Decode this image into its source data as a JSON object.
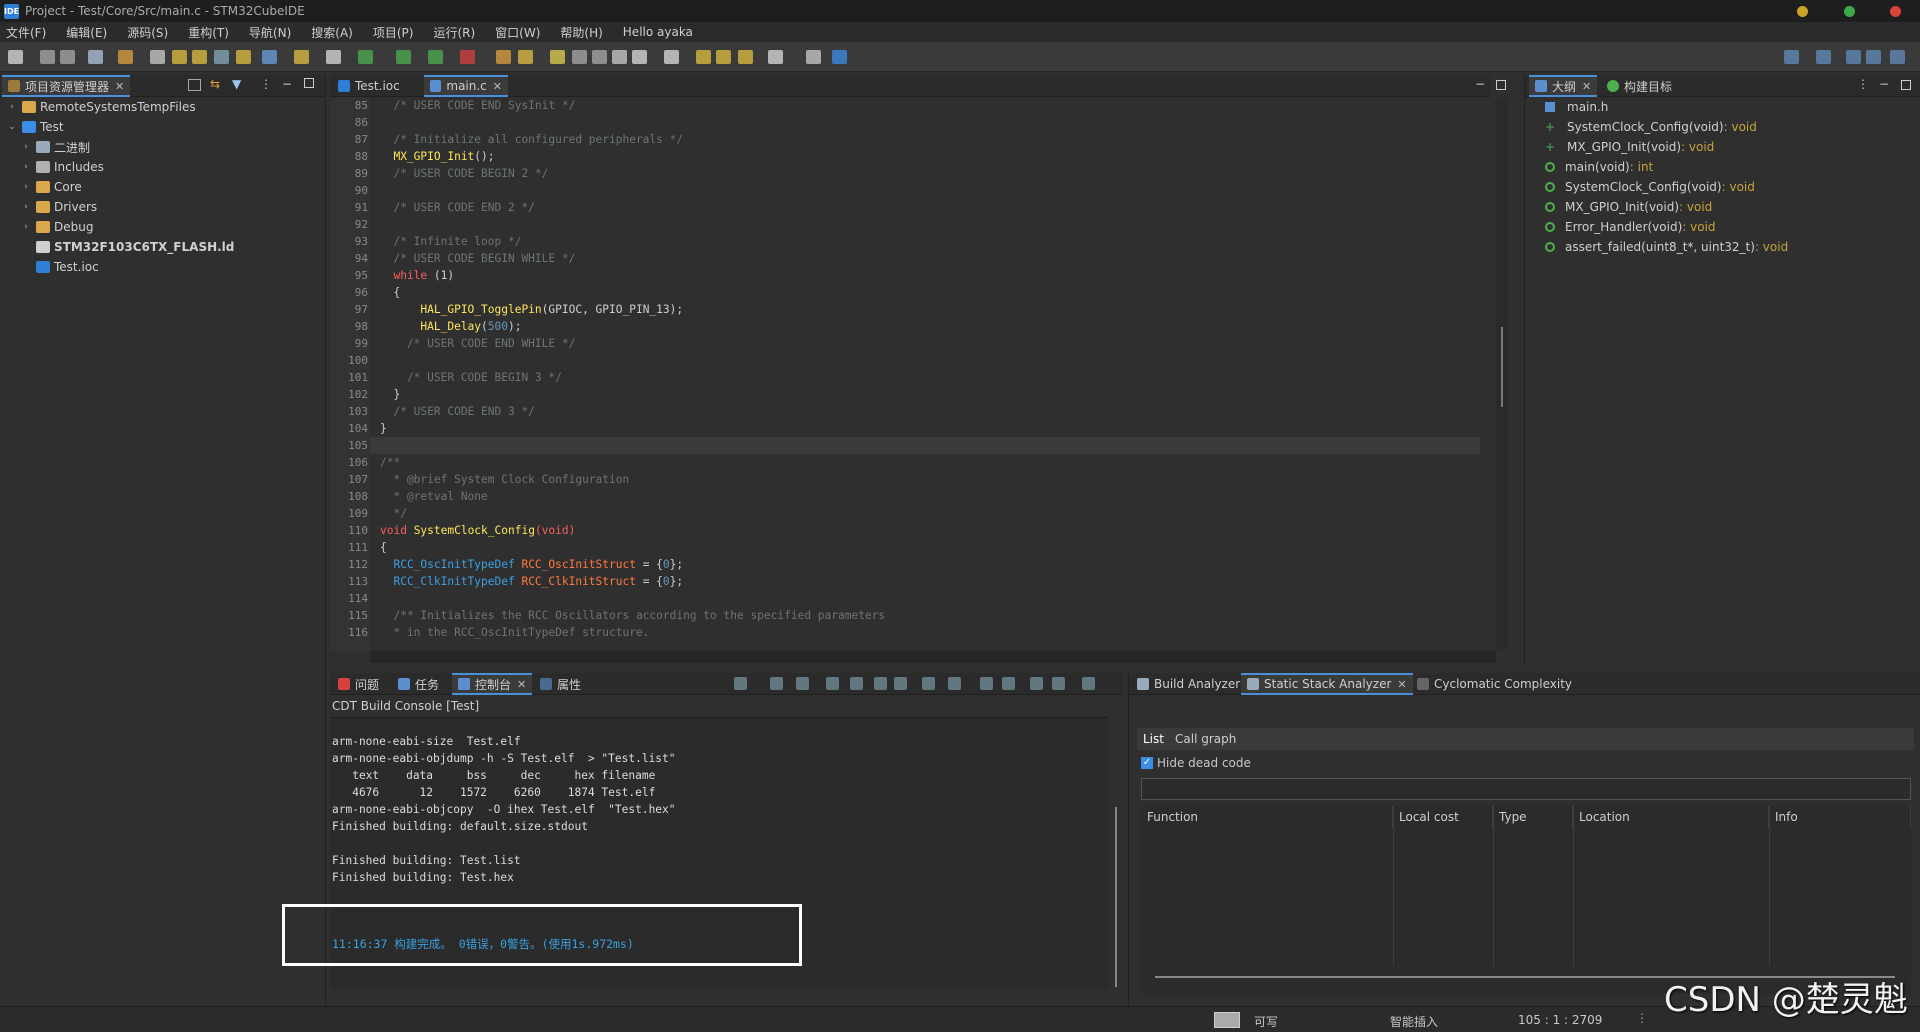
{
  "window": {
    "title": "Project - Test/Core/Src/main.c - STM32CubeIDE",
    "badge": "IDE"
  },
  "menu": [
    "文件(F)",
    "编辑(E)",
    "源码(S)",
    "重构(T)",
    "导航(N)",
    "搜索(A)",
    "项目(P)",
    "运行(R)",
    "窗口(W)",
    "帮助(H)",
    "Hello ayaka"
  ],
  "project_explorer": {
    "tab_label": "项目资源管理器",
    "items": [
      {
        "label": "RemoteSystemsTempFiles",
        "depth": 0,
        "arrow": "›",
        "icon": "folder"
      },
      {
        "label": "Test",
        "depth": 0,
        "arrow": "⌄",
        "icon": "project"
      },
      {
        "label": "二进制",
        "depth": 1,
        "arrow": "›",
        "icon": "binary"
      },
      {
        "label": "Includes",
        "depth": 1,
        "arrow": "›",
        "icon": "includes"
      },
      {
        "label": "Core",
        "depth": 1,
        "arrow": "›",
        "icon": "folder"
      },
      {
        "label": "Drivers",
        "depth": 1,
        "arrow": "›",
        "icon": "folder"
      },
      {
        "label": "Debug",
        "depth": 1,
        "arrow": "›",
        "icon": "folder"
      },
      {
        "label": "STM32F103C6TX_FLASH.ld",
        "depth": 1,
        "arrow": "",
        "icon": "file",
        "bold": true
      },
      {
        "label": "Test.ioc",
        "depth": 1,
        "arrow": "",
        "icon": "mx"
      }
    ]
  },
  "editor": {
    "tabs": [
      {
        "label": "Test.ioc",
        "active": false
      },
      {
        "label": "main.c",
        "active": true
      }
    ],
    "lines": [
      {
        "n": "85",
        "s": [
          [
            "cmt",
            "  /* USER CODE END SysInit */"
          ]
        ]
      },
      {
        "n": "86",
        "s": []
      },
      {
        "n": "87",
        "s": [
          [
            "cmt",
            "  /* Initialize all configured peripherals */"
          ]
        ]
      },
      {
        "n": "88",
        "s": [
          [
            "fn",
            "  MX_GPIO_Init"
          ],
          [
            "con",
            "();"
          ]
        ]
      },
      {
        "n": "89",
        "s": [
          [
            "cmt",
            "  /* USER CODE BEGIN 2 */"
          ]
        ]
      },
      {
        "n": "90",
        "s": []
      },
      {
        "n": "91",
        "s": [
          [
            "cmt",
            "  /* USER CODE END 2 */"
          ]
        ]
      },
      {
        "n": "92",
        "s": []
      },
      {
        "n": "93",
        "s": [
          [
            "cmt",
            "  /* Infinite loop */"
          ]
        ]
      },
      {
        "n": "94",
        "s": [
          [
            "cmt",
            "  /* USER CODE BEGIN WHILE */"
          ]
        ]
      },
      {
        "n": "95",
        "s": [
          [
            "kw",
            "  while"
          ],
          [
            "con",
            " (1)"
          ]
        ]
      },
      {
        "n": "96",
        "s": [
          [
            "con",
            "  {"
          ]
        ]
      },
      {
        "n": "97",
        "s": [
          [
            "fn",
            "      HAL_GPIO_TogglePin"
          ],
          [
            "con",
            "(GPIOC, GPIO_PIN_13);"
          ]
        ]
      },
      {
        "n": "98",
        "s": [
          [
            "fn",
            "      HAL_Delay"
          ],
          [
            "con",
            "("
          ],
          [
            "num",
            "500"
          ],
          [
            "con",
            ");"
          ]
        ]
      },
      {
        "n": "99",
        "s": [
          [
            "cmt",
            "    /* USER CODE END WHILE */"
          ]
        ]
      },
      {
        "n": "100",
        "s": []
      },
      {
        "n": "101",
        "s": [
          [
            "cmt",
            "    /* USER CODE BEGIN 3 */"
          ]
        ]
      },
      {
        "n": "102",
        "s": [
          [
            "con",
            "  }"
          ]
        ]
      },
      {
        "n": "103",
        "s": [
          [
            "cmt",
            "  /* USER CODE END 3 */"
          ]
        ]
      },
      {
        "n": "104",
        "s": [
          [
            "con",
            "}"
          ]
        ]
      },
      {
        "n": "105",
        "s": []
      },
      {
        "n": "106",
        "s": [
          [
            "cmt",
            "/**"
          ]
        ]
      },
      {
        "n": "107",
        "s": [
          [
            "cmt",
            "  * @brief System Clock Configuration"
          ]
        ]
      },
      {
        "n": "108",
        "s": [
          [
            "cmt",
            "  * @retval None"
          ]
        ]
      },
      {
        "n": "109",
        "s": [
          [
            "cmt",
            "  */"
          ]
        ]
      },
      {
        "n": "110",
        "s": [
          [
            "kw",
            "void"
          ],
          [
            "fn",
            " SystemClock_Config"
          ],
          [
            "kw",
            "(void)"
          ]
        ]
      },
      {
        "n": "111",
        "s": [
          [
            "con",
            "{"
          ]
        ]
      },
      {
        "n": "112",
        "s": [
          [
            "ty",
            "  RCC_OscInitTypeDef"
          ],
          [
            "var",
            " RCC_OscInitStruct"
          ],
          [
            "con",
            " = {"
          ],
          [
            "num",
            "0"
          ],
          [
            "con",
            "};"
          ]
        ]
      },
      {
        "n": "113",
        "s": [
          [
            "ty",
            "  RCC_ClkInitTypeDef"
          ],
          [
            "var",
            " RCC_ClkInitStruct"
          ],
          [
            "con",
            " = {"
          ],
          [
            "num",
            "0"
          ],
          [
            "con",
            "};"
          ]
        ]
      },
      {
        "n": "114",
        "s": []
      },
      {
        "n": "115",
        "s": [
          [
            "cmt",
            "  /** Initializes the RCC Oscillators according to the specified parameters"
          ]
        ]
      },
      {
        "n": "116",
        "s": [
          [
            "cmt",
            "  * in the RCC_OscInitTypeDef structure."
          ]
        ]
      }
    ]
  },
  "outline": {
    "tabs": [
      "大纲",
      "构建目标"
    ],
    "items": [
      {
        "label": "main.h",
        "ret": "",
        "icon": "include"
      },
      {
        "label": "SystemClock_Config(void)",
        "ret": " : void",
        "icon": "decl"
      },
      {
        "label": "MX_GPIO_Init(void)",
        "ret": " : void",
        "icon": "decl-s"
      },
      {
        "label": "main(void)",
        "ret": " : int",
        "icon": "func"
      },
      {
        "label": "SystemClock_Config(void)",
        "ret": " : void",
        "icon": "func"
      },
      {
        "label": "MX_GPIO_Init(void)",
        "ret": " : void",
        "icon": "func-s"
      },
      {
        "label": "Error_Handler(void)",
        "ret": " : void",
        "icon": "func"
      },
      {
        "label": "assert_failed(uint8_t*, uint32_t)",
        "ret": " : void",
        "icon": "func-x"
      }
    ]
  },
  "console": {
    "tabs": [
      "问题",
      "任务",
      "控制台",
      "属性"
    ],
    "header": "CDT Build Console [Test]",
    "lines": [
      "arm-none-eabi-size  Test.elf",
      "arm-none-eabi-objdump -h -S Test.elf  > \"Test.list\"",
      "   text    data     bss     dec     hex filename",
      "   4676      12    1572    6260    1874 Test.elf",
      "arm-none-eabi-objcopy  -O ihex Test.elf  \"Test.hex\"",
      "Finished building: default.size.stdout",
      "",
      "Finished building: Test.list",
      "Finished building: Test.hex"
    ],
    "result": "11:16:37 构建完成。 0错误，0警告。(使用1s.972ms)"
  },
  "analyzer": {
    "tabs": [
      "Build Analyzer",
      "Static Stack Analyzer",
      "Cyclomatic Complexity"
    ],
    "subtabs": [
      "List",
      "Call graph"
    ],
    "hide_dead_code": "Hide dead code",
    "columns": [
      "Function",
      "Local cost",
      "Type",
      "Location",
      "Info"
    ]
  },
  "statusbar": {
    "writable": "可写",
    "insert": "智能插入",
    "position": "105 : 1 : 2709"
  },
  "watermark": "CSDN @楚灵魁",
  "colors": {
    "accent": "#4a90d9",
    "highlight_box": "#ffffff",
    "result_text": "#3aa0e0"
  }
}
